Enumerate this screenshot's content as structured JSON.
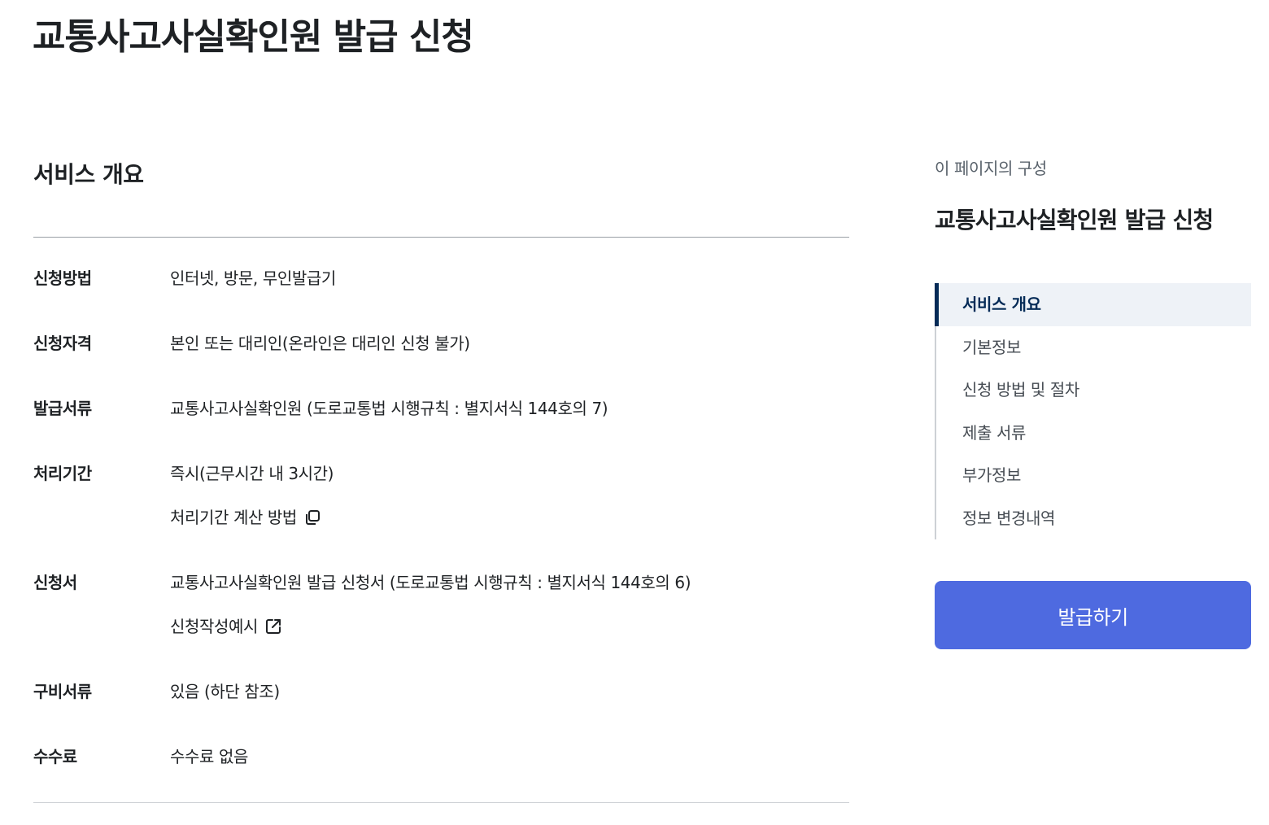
{
  "page": {
    "title": "교통사고사실확인원 발급 신청"
  },
  "overview": {
    "heading": "서비스 개요",
    "rows": [
      {
        "label": "신청방법",
        "values": [
          "인터넷, 방문, 무인발급기"
        ]
      },
      {
        "label": "신청자격",
        "values": [
          "본인 또는 대리인(온라인은 대리인 신청 불가)"
        ]
      },
      {
        "label": "발급서류",
        "values": [
          "교통사고사실확인원 (도로교통법 시행규칙 : 별지서식 144호의 7)"
        ]
      },
      {
        "label": "처리기간",
        "values": [
          "즉시(근무시간 내 3시간)"
        ],
        "link": {
          "text": "처리기간 계산 방법",
          "icon": "copy-window-icon"
        }
      },
      {
        "label": "신청서",
        "values": [
          "교통사고사실확인원 발급 신청서 (도로교통법 시행규칙 : 별지서식 144호의 6)"
        ],
        "link": {
          "text": "신청작성예시",
          "icon": "external-link-icon"
        }
      },
      {
        "label": "구비서류",
        "values": [
          "있음 (하단 참조)"
        ]
      },
      {
        "label": "수수료",
        "values": [
          "수수료 없음"
        ]
      }
    ]
  },
  "toc": {
    "caption": "이 페이지의 구성",
    "title": "교통사고사실확인원 발급 신청",
    "items": [
      {
        "label": "서비스 개요",
        "active": true
      },
      {
        "label": "기본정보",
        "active": false
      },
      {
        "label": "신청 방법 및 절차",
        "active": false
      },
      {
        "label": "제출 서류",
        "active": false
      },
      {
        "label": "부가정보",
        "active": false
      },
      {
        "label": "정보 변경내역",
        "active": false
      }
    ]
  },
  "actions": {
    "issue_label": "발급하기"
  },
  "colors": {
    "primary_button": "#4e6ae0",
    "toc_active_bar": "#052b57",
    "toc_active_bg": "#eef2f7"
  }
}
